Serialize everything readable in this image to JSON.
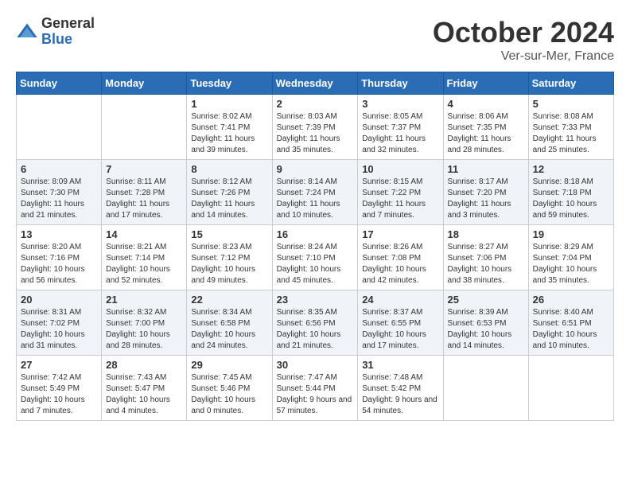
{
  "header": {
    "logo_general": "General",
    "logo_blue": "Blue",
    "month": "October 2024",
    "location": "Ver-sur-Mer, France"
  },
  "weekdays": [
    "Sunday",
    "Monday",
    "Tuesday",
    "Wednesday",
    "Thursday",
    "Friday",
    "Saturday"
  ],
  "weeks": [
    [
      {
        "day": "",
        "info": ""
      },
      {
        "day": "",
        "info": ""
      },
      {
        "day": "1",
        "info": "Sunrise: 8:02 AM\nSunset: 7:41 PM\nDaylight: 11 hours and 39 minutes."
      },
      {
        "day": "2",
        "info": "Sunrise: 8:03 AM\nSunset: 7:39 PM\nDaylight: 11 hours and 35 minutes."
      },
      {
        "day": "3",
        "info": "Sunrise: 8:05 AM\nSunset: 7:37 PM\nDaylight: 11 hours and 32 minutes."
      },
      {
        "day": "4",
        "info": "Sunrise: 8:06 AM\nSunset: 7:35 PM\nDaylight: 11 hours and 28 minutes."
      },
      {
        "day": "5",
        "info": "Sunrise: 8:08 AM\nSunset: 7:33 PM\nDaylight: 11 hours and 25 minutes."
      }
    ],
    [
      {
        "day": "6",
        "info": "Sunrise: 8:09 AM\nSunset: 7:30 PM\nDaylight: 11 hours and 21 minutes."
      },
      {
        "day": "7",
        "info": "Sunrise: 8:11 AM\nSunset: 7:28 PM\nDaylight: 11 hours and 17 minutes."
      },
      {
        "day": "8",
        "info": "Sunrise: 8:12 AM\nSunset: 7:26 PM\nDaylight: 11 hours and 14 minutes."
      },
      {
        "day": "9",
        "info": "Sunrise: 8:14 AM\nSunset: 7:24 PM\nDaylight: 11 hours and 10 minutes."
      },
      {
        "day": "10",
        "info": "Sunrise: 8:15 AM\nSunset: 7:22 PM\nDaylight: 11 hours and 7 minutes."
      },
      {
        "day": "11",
        "info": "Sunrise: 8:17 AM\nSunset: 7:20 PM\nDaylight: 11 hours and 3 minutes."
      },
      {
        "day": "12",
        "info": "Sunrise: 8:18 AM\nSunset: 7:18 PM\nDaylight: 10 hours and 59 minutes."
      }
    ],
    [
      {
        "day": "13",
        "info": "Sunrise: 8:20 AM\nSunset: 7:16 PM\nDaylight: 10 hours and 56 minutes."
      },
      {
        "day": "14",
        "info": "Sunrise: 8:21 AM\nSunset: 7:14 PM\nDaylight: 10 hours and 52 minutes."
      },
      {
        "day": "15",
        "info": "Sunrise: 8:23 AM\nSunset: 7:12 PM\nDaylight: 10 hours and 49 minutes."
      },
      {
        "day": "16",
        "info": "Sunrise: 8:24 AM\nSunset: 7:10 PM\nDaylight: 10 hours and 45 minutes."
      },
      {
        "day": "17",
        "info": "Sunrise: 8:26 AM\nSunset: 7:08 PM\nDaylight: 10 hours and 42 minutes."
      },
      {
        "day": "18",
        "info": "Sunrise: 8:27 AM\nSunset: 7:06 PM\nDaylight: 10 hours and 38 minutes."
      },
      {
        "day": "19",
        "info": "Sunrise: 8:29 AM\nSunset: 7:04 PM\nDaylight: 10 hours and 35 minutes."
      }
    ],
    [
      {
        "day": "20",
        "info": "Sunrise: 8:31 AM\nSunset: 7:02 PM\nDaylight: 10 hours and 31 minutes."
      },
      {
        "day": "21",
        "info": "Sunrise: 8:32 AM\nSunset: 7:00 PM\nDaylight: 10 hours and 28 minutes."
      },
      {
        "day": "22",
        "info": "Sunrise: 8:34 AM\nSunset: 6:58 PM\nDaylight: 10 hours and 24 minutes."
      },
      {
        "day": "23",
        "info": "Sunrise: 8:35 AM\nSunset: 6:56 PM\nDaylight: 10 hours and 21 minutes."
      },
      {
        "day": "24",
        "info": "Sunrise: 8:37 AM\nSunset: 6:55 PM\nDaylight: 10 hours and 17 minutes."
      },
      {
        "day": "25",
        "info": "Sunrise: 8:39 AM\nSunset: 6:53 PM\nDaylight: 10 hours and 14 minutes."
      },
      {
        "day": "26",
        "info": "Sunrise: 8:40 AM\nSunset: 6:51 PM\nDaylight: 10 hours and 10 minutes."
      }
    ],
    [
      {
        "day": "27",
        "info": "Sunrise: 7:42 AM\nSunset: 5:49 PM\nDaylight: 10 hours and 7 minutes."
      },
      {
        "day": "28",
        "info": "Sunrise: 7:43 AM\nSunset: 5:47 PM\nDaylight: 10 hours and 4 minutes."
      },
      {
        "day": "29",
        "info": "Sunrise: 7:45 AM\nSunset: 5:46 PM\nDaylight: 10 hours and 0 minutes."
      },
      {
        "day": "30",
        "info": "Sunrise: 7:47 AM\nSunset: 5:44 PM\nDaylight: 9 hours and 57 minutes."
      },
      {
        "day": "31",
        "info": "Sunrise: 7:48 AM\nSunset: 5:42 PM\nDaylight: 9 hours and 54 minutes."
      },
      {
        "day": "",
        "info": ""
      },
      {
        "day": "",
        "info": ""
      }
    ]
  ]
}
